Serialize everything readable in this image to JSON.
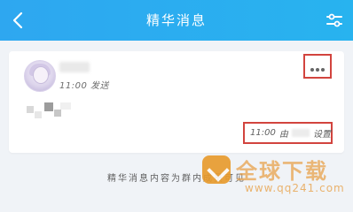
{
  "header": {
    "back_icon": "chevron-left-icon",
    "title": "精华消息",
    "filter_icon": "sliders-icon",
    "bg_color": "#2ea7f0",
    "fg_color": "#ffffff"
  },
  "message": {
    "time": "11:00",
    "action": "发送",
    "set_time": "11:00",
    "set_by": "由",
    "set_action": "设置",
    "more_icon": "ellipsis-icon",
    "highlight_color": "#d2443e"
  },
  "footer": {
    "note": "精华消息内容为群内成员可见"
  },
  "watermark": {
    "brand": "全球下载",
    "url": "www.qq241.com",
    "color": "#e8a24b"
  }
}
